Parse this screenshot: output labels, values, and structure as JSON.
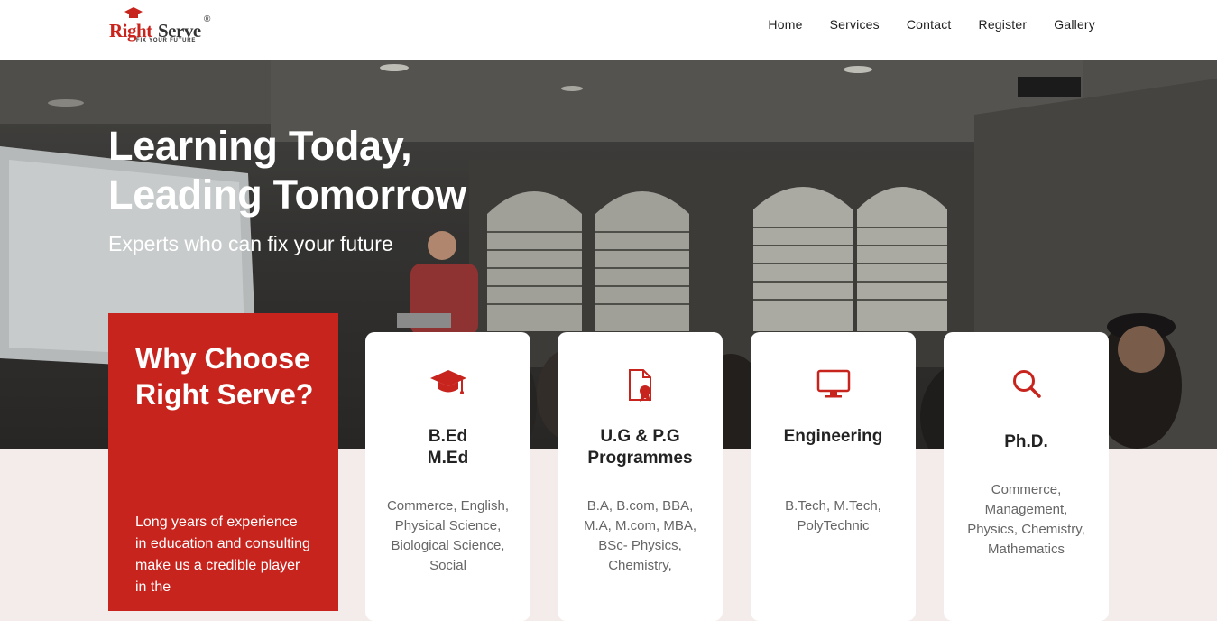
{
  "brand": {
    "name_part1": "Right",
    "name_part2": "Serve",
    "registered": "®",
    "tagline": "FIX YOUR FUTURE",
    "accent_color": "#c8241e"
  },
  "nav": {
    "items": [
      {
        "label": "Home"
      },
      {
        "label": "Services"
      },
      {
        "label": "Contact"
      },
      {
        "label": "Register"
      },
      {
        "label": "Gallery"
      }
    ]
  },
  "hero": {
    "title_line1": "Learning Today,",
    "title_line2": "Leading Tomorrow",
    "subtitle": "Experts who can fix your future"
  },
  "why": {
    "title": "Why Choose Right Serve?",
    "text": "Long years of experience in education and consulting make us a credible player in the"
  },
  "services": [
    {
      "icon": "graduation-cap-icon",
      "title": "B.Ed\nM.Ed",
      "desc": "Commerce, English, Physical Science, Biological Science, Social"
    },
    {
      "icon": "certificate-document-icon",
      "title": "U.G & P.G\nProgrammes",
      "desc": "B.A, B.com, BBA, M.A, M.com, MBA, BSc- Physics, Chemistry,"
    },
    {
      "icon": "monitor-icon",
      "title": "Engineering",
      "desc": "B.Tech, M.Tech, PolyTechnic"
    },
    {
      "icon": "search-icon",
      "title": "Ph.D.",
      "desc": "Commerce, Management, Physics, Chemistry, Mathematics"
    }
  ]
}
